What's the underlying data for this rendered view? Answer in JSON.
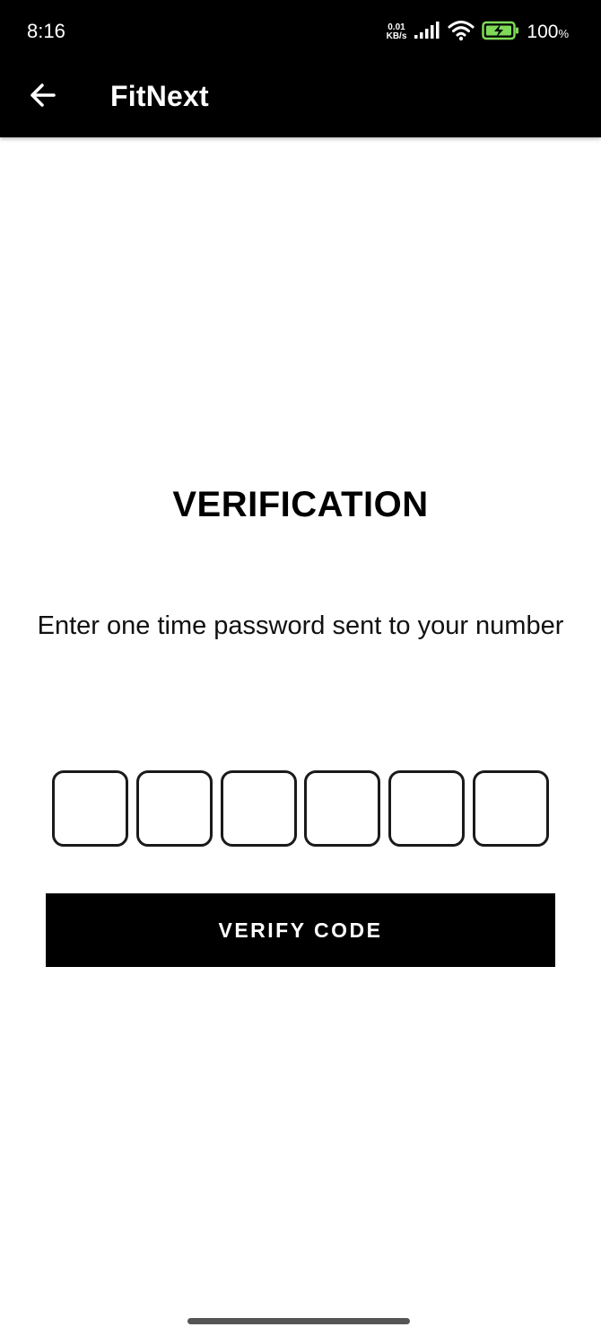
{
  "status_bar": {
    "time": "8:16",
    "net_speed_value": "0.01",
    "net_speed_unit": "KB/s",
    "battery_percent": "100",
    "battery_percent_sign": "%"
  },
  "app_bar": {
    "title": "FitNext",
    "back_icon": "arrow-left-icon"
  },
  "main": {
    "heading": "VERIFICATION",
    "subtitle": "Enter one time password sent to your number",
    "otp_digits": [
      "",
      "",
      "",
      "",
      "",
      ""
    ],
    "verify_button_label": "VERIFY CODE"
  },
  "colors": {
    "bar_background": "#000000",
    "page_background": "#ffffff",
    "button_background": "#000000"
  }
}
